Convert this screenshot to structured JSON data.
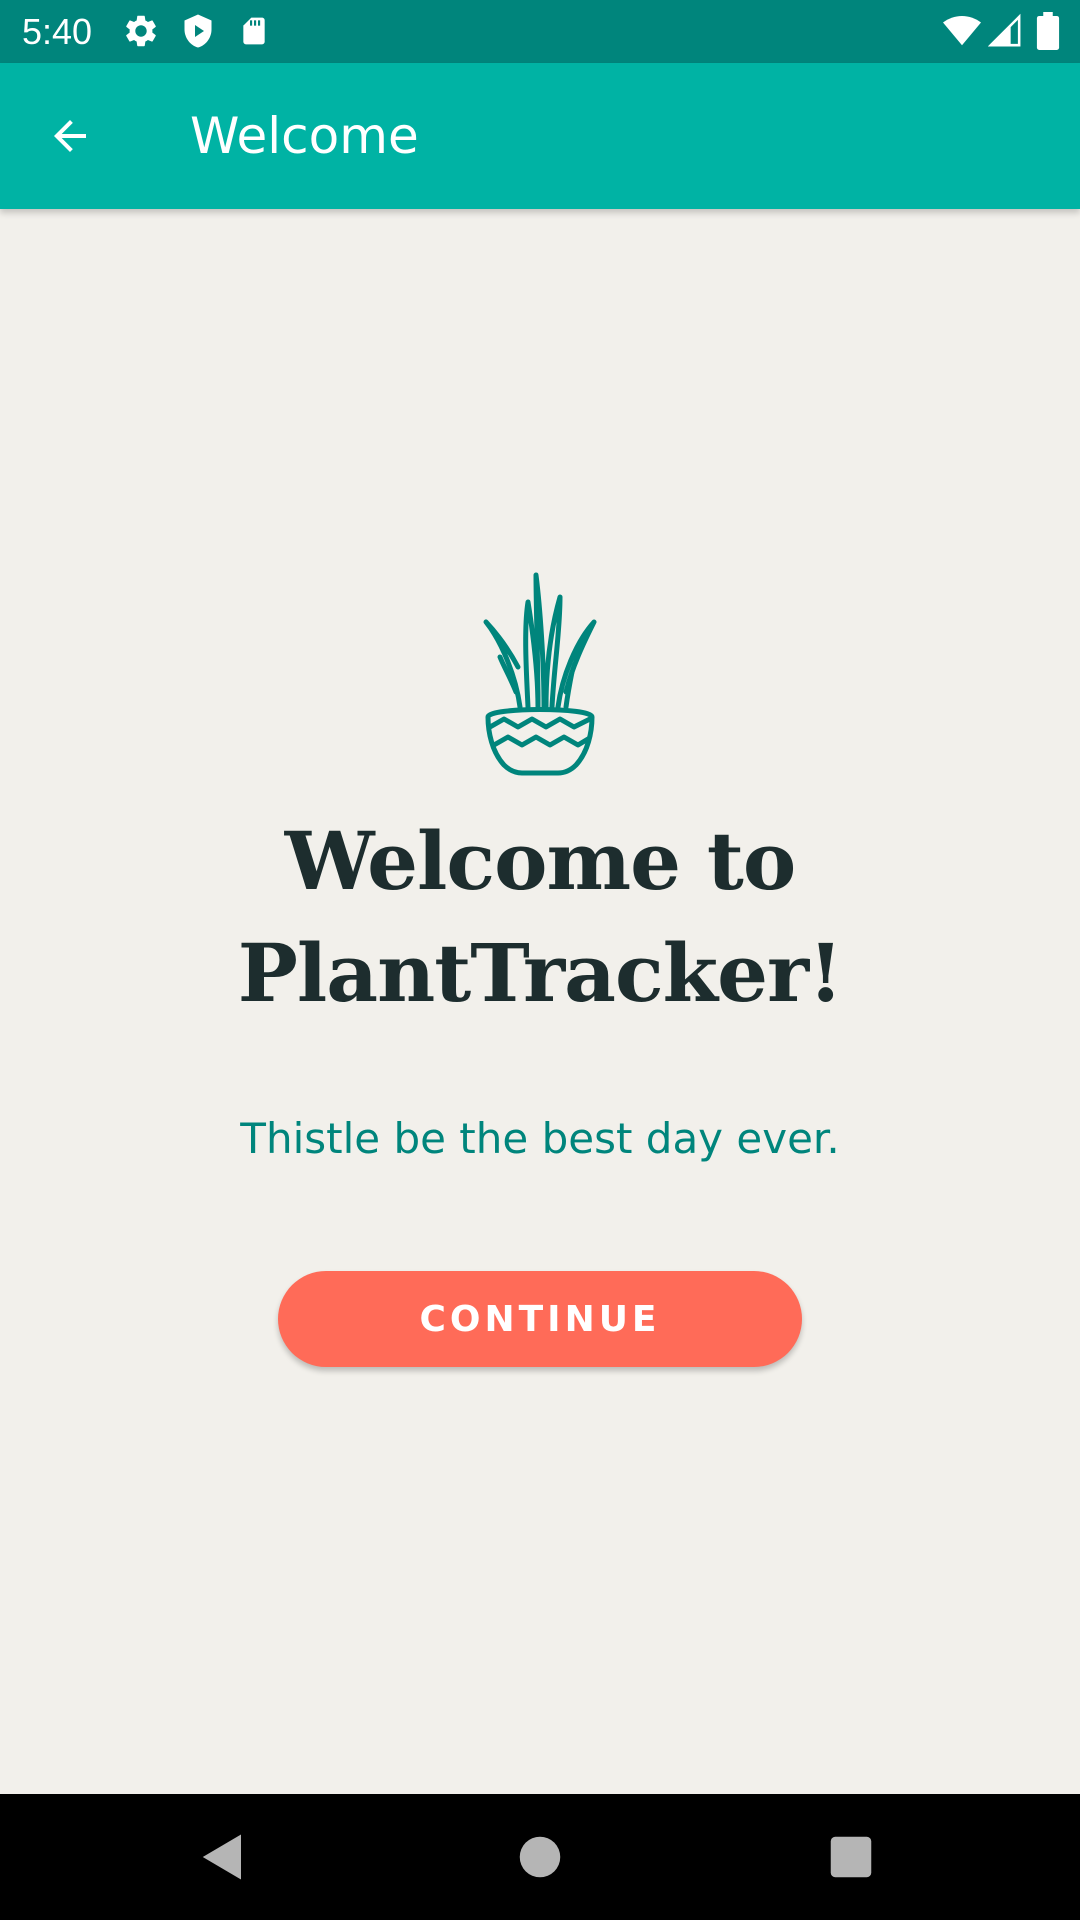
{
  "status_bar": {
    "time": "5:40",
    "icons": [
      "settings-icon",
      "shield-play-icon",
      "sd-card-icon",
      "wifi-icon",
      "signal-icon",
      "battery-icon"
    ]
  },
  "app_bar": {
    "title": "Welcome",
    "back_icon": "arrow-back-icon"
  },
  "main": {
    "illustration": "potted-plant-icon",
    "title": "Welcome to PlantTracker!",
    "tagline": "Thistle be the best day ever.",
    "continue_label": "CONTINUE"
  },
  "nav_bar": {
    "buttons": [
      "back-triangle-icon",
      "home-circle-icon",
      "recents-square-icon"
    ]
  },
  "colors": {
    "status_bar": "#00857c",
    "app_bar": "#00b3a4",
    "background": "#f2f0eb",
    "accent_teal": "#00857c",
    "title_text": "#1d2d2e",
    "button": "#ff6b58"
  }
}
